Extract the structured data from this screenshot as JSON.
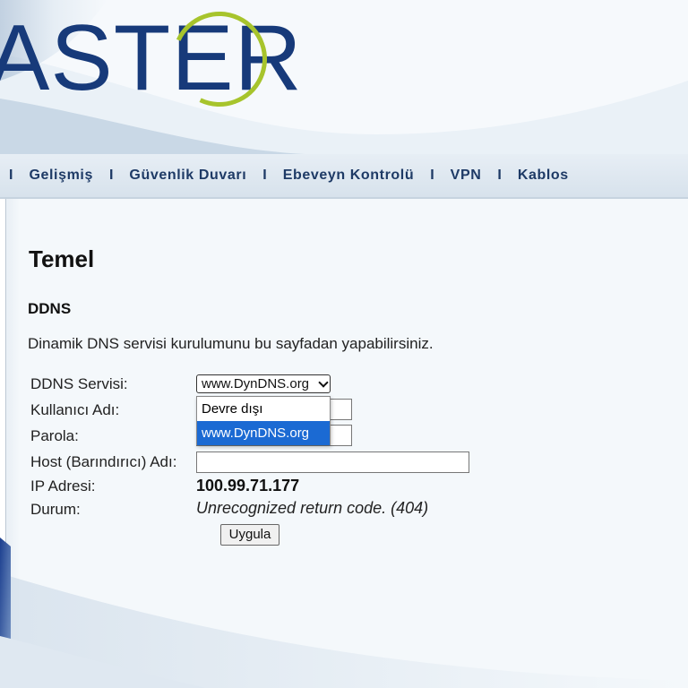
{
  "brand": {
    "logo_text": "ASTER",
    "accent": "#a7c42c",
    "brand_color": "#173a7a"
  },
  "nav": {
    "items": [
      {
        "label": "Gelişmiş"
      },
      {
        "label": "Güvenlik Duvarı"
      },
      {
        "label": "Ebeveyn Kontrolü"
      },
      {
        "label": "VPN"
      },
      {
        "label": "Kablos"
      }
    ],
    "separator": "I"
  },
  "page": {
    "title": "Temel",
    "section": "DDNS",
    "description": "Dinamik DNS servisi kurulumunu bu sayfadan yapabilirsiniz."
  },
  "form": {
    "ddns_service_label": "DDNS Servisi:",
    "ddns_service_value": "www.DynDNS.org",
    "ddns_service_options": [
      "Devre dışı",
      "www.DynDNS.org"
    ],
    "username_label": "Kullanıcı Adı:",
    "password_label": "Parola:",
    "host_label": "Host (Barındırıcı) Adı:",
    "ip_label": "IP Adresi:",
    "ip_value": "100.99.71.177",
    "status_label": "Durum:",
    "status_value": "Unrecognized return code. (404)",
    "apply_label": "Uygula"
  },
  "colors": {
    "dropdown_highlight": "#1b6ad3",
    "nav_text": "#1e3a66"
  }
}
